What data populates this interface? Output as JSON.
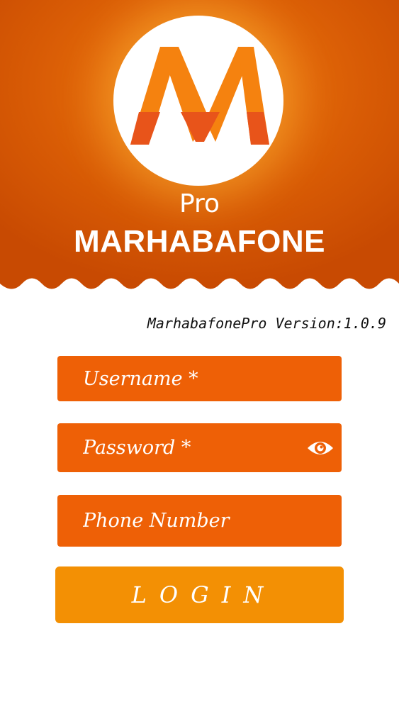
{
  "brand": {
    "logo_letter": "M",
    "subtitle": "Pro",
    "name": "MARHABAFONE"
  },
  "version_text": "MarhabafonePro Version:1.0.9",
  "form": {
    "username_placeholder": "Username *",
    "password_placeholder": "Password *",
    "phone_placeholder": "Phone Number",
    "password_toggle_icon": "eye-icon",
    "login_label": "LOGIN"
  },
  "colors": {
    "header_dark": "#c84a02",
    "header_light": "#f07a10",
    "field_bg": "#ee6006",
    "login_bg": "#f39004",
    "logo_orange": "#f5820f",
    "logo_red": "#e8541a"
  }
}
